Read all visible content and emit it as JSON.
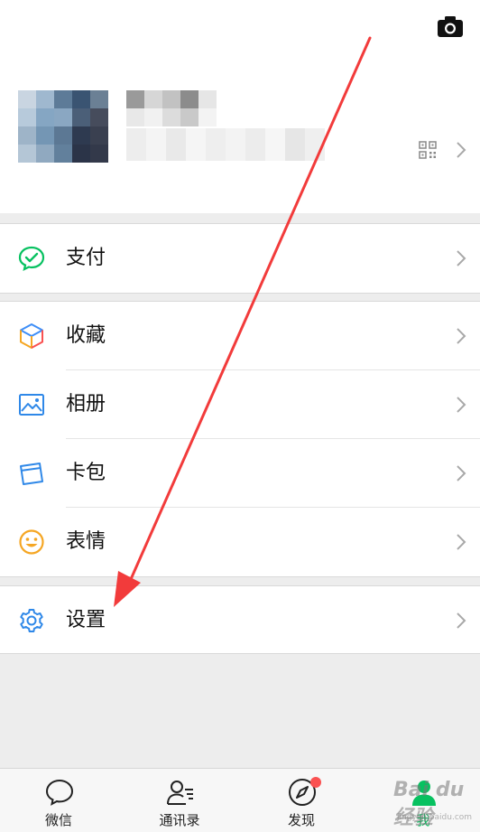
{
  "profile": {
    "camera_icon": "camera-icon",
    "qr_icon": "qr-code-icon"
  },
  "menu": {
    "pay": {
      "label": "支付",
      "icon": "wechat-pay-icon"
    },
    "favorites": {
      "label": "收藏",
      "icon": "favorites-cube-icon"
    },
    "album": {
      "label": "相册",
      "icon": "photo-album-icon"
    },
    "cards": {
      "label": "卡包",
      "icon": "card-wallet-icon"
    },
    "stickers": {
      "label": "表情",
      "icon": "smiley-icon"
    },
    "settings": {
      "label": "设置",
      "icon": "gear-icon"
    }
  },
  "tabbar": {
    "chats": {
      "label": "微信",
      "icon": "chat-bubble-icon"
    },
    "contacts": {
      "label": "通讯录",
      "icon": "contacts-icon"
    },
    "discover": {
      "label": "发现",
      "icon": "compass-icon",
      "has_badge": true
    },
    "me": {
      "label": "我",
      "icon": "person-icon",
      "active": true
    }
  },
  "watermark": {
    "brand": "Bai du 经验",
    "url": "jingyan.baidu.com"
  },
  "colors": {
    "accent_green": "#07c160",
    "badge_red": "#fa5151",
    "arrow_red": "#f23b3b",
    "background": "#ededed"
  }
}
